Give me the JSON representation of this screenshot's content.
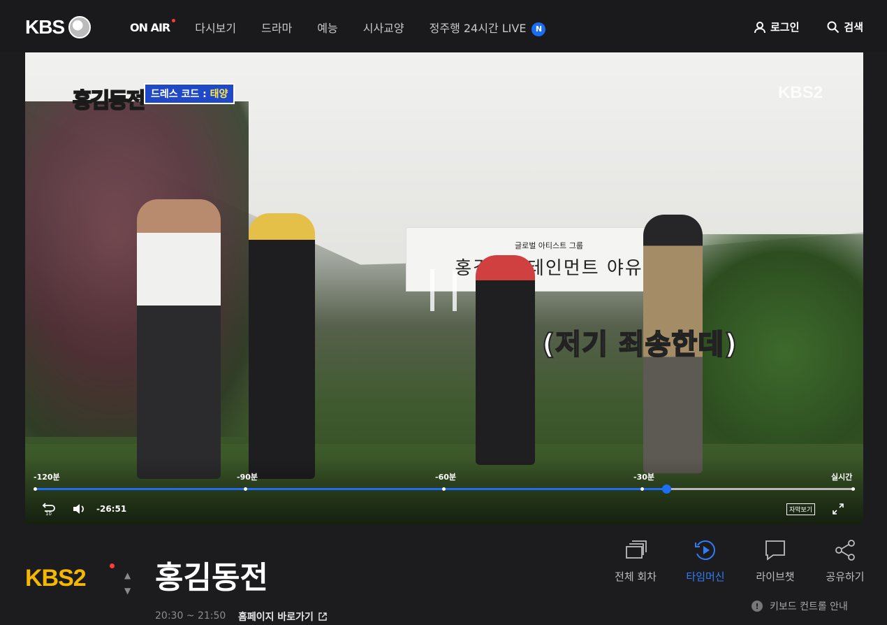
{
  "header": {
    "logo": "KBS",
    "nav": [
      {
        "label": "ON AIR",
        "active": true
      },
      {
        "label": "다시보기"
      },
      {
        "label": "드라마"
      },
      {
        "label": "예능"
      },
      {
        "label": "시사교양"
      },
      {
        "label": "정주행 24시간 LIVE",
        "badge": "N"
      }
    ],
    "login": "로그인",
    "search": "검색"
  },
  "player": {
    "show_logo": "홍김동전",
    "dress_code_prefix": "드레스 코드 : ",
    "dress_code_value": "태양",
    "watermark": "KBS2",
    "banner_small": "글로벌 아티스트 그룹",
    "banner_big": "홍김엔터테인먼트 야유",
    "caption": "(저기 죄송한데)",
    "timeline": {
      "labels": [
        "-120분",
        "-90분",
        "-60분",
        "-30분",
        "실시간"
      ],
      "progress": 0.77
    },
    "time": "-26:51",
    "caption_toggle": "자막보기"
  },
  "program": {
    "channel": "KBS2",
    "title": "홍김동전",
    "time": "20:30 ~ 21:50",
    "homepage": "홈페이지 바로가기"
  },
  "actions": [
    {
      "label": "전체 회차",
      "icon": "episodes-icon"
    },
    {
      "label": "타임머신",
      "icon": "timemachine-icon",
      "active": true
    },
    {
      "label": "라이브챗",
      "icon": "chat-icon"
    },
    {
      "label": "공유하기",
      "icon": "share-icon"
    }
  ],
  "keyboard_guide": "키보드 컨트롤 안내",
  "colors": {
    "accent": "#1d6ef5",
    "background": "#1c1c1f"
  }
}
